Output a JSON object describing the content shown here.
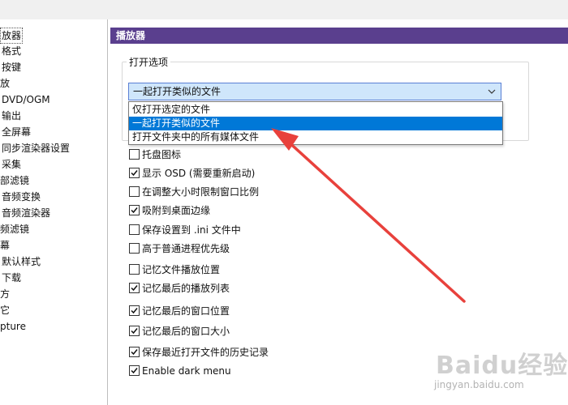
{
  "sidebar": {
    "items": [
      {
        "label": "放器",
        "selected": true
      },
      {
        "label": "格式"
      },
      {
        "label": "按键"
      },
      {
        "label": "放"
      },
      {
        "label": "DVD/OGM"
      },
      {
        "label": "输出"
      },
      {
        "label": "全屏幕"
      },
      {
        "label": "同步渲染器设置"
      },
      {
        "label": "采集"
      },
      {
        "label": "部滤镜"
      },
      {
        "label": "音频变换"
      },
      {
        "label": "音频渲染器"
      },
      {
        "label": "频滤镜"
      },
      {
        "label": "幕"
      },
      {
        "label": "默认样式"
      },
      {
        "label": "下载"
      },
      {
        "label": "方"
      },
      {
        "label": "它"
      },
      {
        "label": "pture"
      }
    ]
  },
  "panel": {
    "header": "播放器",
    "open_options": {
      "title": "打开选项",
      "combo_value": "一起打开类似的文件",
      "dropdown_options": [
        {
          "label": "仅打开选定的文件",
          "highlighted": false
        },
        {
          "label": "一起打开类似的文件",
          "highlighted": true
        },
        {
          "label": "打开文件夹中的所有媒体文件",
          "highlighted": false
        }
      ]
    },
    "checkboxes": [
      {
        "label": "托盘图标",
        "checked": false
      },
      {
        "label": "显示 OSD (需要重新启动)",
        "checked": true
      },
      {
        "label": "在调整大小时限制窗口比例",
        "checked": false
      },
      {
        "label": "吸附到桌面边缘",
        "checked": true
      },
      {
        "label": "保存设置到 .ini 文件中",
        "checked": false
      },
      {
        "label": "高于普通进程优先级",
        "checked": false
      },
      {
        "label": "记忆文件播放位置",
        "checked": false
      },
      {
        "label": "记忆最后的播放列表",
        "checked": true
      },
      {
        "label": "记忆最后的窗口位置",
        "checked": true
      },
      {
        "label": "记忆最后的窗口大小",
        "checked": true
      },
      {
        "label": "保存最近打开文件的历史记录",
        "checked": true
      },
      {
        "label": "Enable dark menu",
        "checked": true
      }
    ]
  },
  "annotation": {
    "color": "#e8413c"
  },
  "watermark": {
    "brand": "Baidu经验",
    "url": "jingyan.baidu.com"
  },
  "colors": {
    "header_bg": "#5a3f8e",
    "highlight": "#0078d7",
    "combo_bg": "#cfe6fb"
  }
}
